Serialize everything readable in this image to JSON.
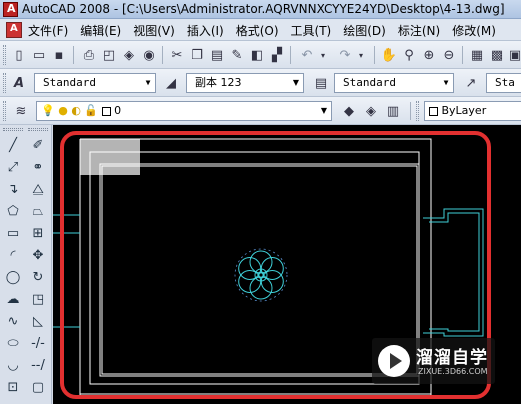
{
  "window": {
    "title": "AutoCAD 2008 - [C:\\Users\\Administrator.AQRVNNXCYYE24YD\\Desktop\\4-13.dwg]"
  },
  "menu": {
    "items": [
      "文件(F)",
      "编辑(E)",
      "视图(V)",
      "插入(I)",
      "格式(O)",
      "工具(T)",
      "绘图(D)",
      "标注(N)",
      "修改(M)"
    ]
  },
  "styles_toolbar": {
    "text_style": "Standard",
    "dim_style": "副本 123",
    "table_style": "Standard",
    "multileader_style": "Sta"
  },
  "layers_toolbar": {
    "layer_name": "0",
    "color_control": "ByLayer"
  },
  "watermark": {
    "title": "溜溜自学",
    "url": "ZIXUE.3D66.COM"
  },
  "colors": {
    "canvas_bg": "#000000",
    "drawing_lines": "#ffffff",
    "accent_cyan": "#3fd0d8",
    "annotation_red": "#e23030",
    "selection_gray": "#b4b4b4"
  }
}
